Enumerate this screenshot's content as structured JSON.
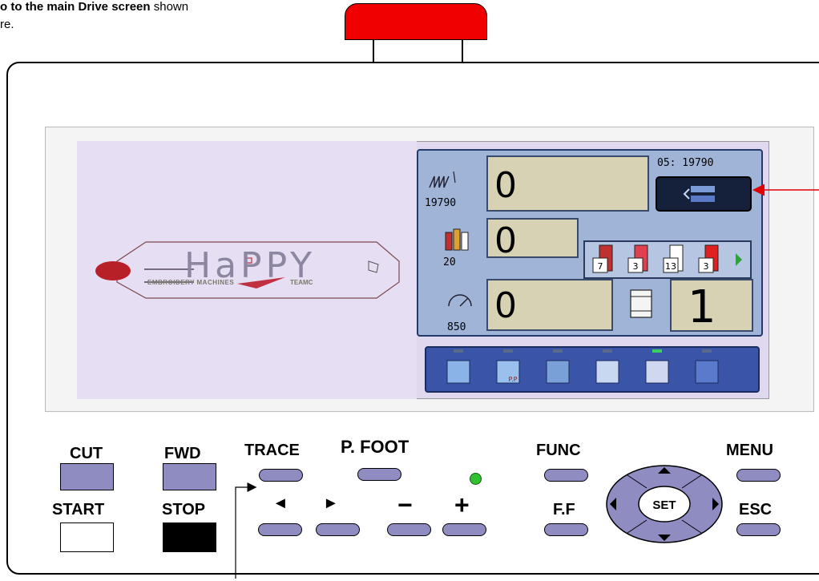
{
  "header": {
    "line1_bold": "o to the main Drive screen",
    "line1_rest": " shown",
    "line2": "re."
  },
  "colors": {
    "red_button": "#f00000",
    "key_fill": "#8f8cc2",
    "status_panel": "#9fb4d6",
    "value_display": "#d8d2b4",
    "icon_bar": "#3a55a8",
    "led": "#30c030",
    "callout_red": "#e00000"
  },
  "screen": {
    "logo_text": "HaPPY",
    "logo_sub_left": "EMBROIDERY MACHINES",
    "logo_sub_right": "TEAMC"
  },
  "status": {
    "stitch": {
      "icon": "stitch-count-icon",
      "total": "19790",
      "value": "0"
    },
    "design_counter": "05: 19790",
    "drive_button_icon": "drive-mode-icon",
    "color": {
      "icon": "thread-color-icon",
      "total": "20",
      "value": "0"
    },
    "needles": [
      {
        "number": "7",
        "color": "#c03030"
      },
      {
        "number": "3",
        "color": "#e04050"
      },
      {
        "number": "13",
        "color": "#ffffff"
      },
      {
        "number": "3",
        "color": "#e02020"
      }
    ],
    "next_icon": "next-arrow-icon",
    "speed": {
      "icon": "speed-gauge-icon",
      "total": "850",
      "value": "0"
    },
    "frame_icon": "frame-icon",
    "repeat_value": "1"
  },
  "icon_bar": {
    "items": [
      {
        "name": "design-select-icon"
      },
      {
        "name": "pattern-program-icon",
        "text": "P.P"
      },
      {
        "name": "thread-tension-icon"
      },
      {
        "name": "repeat-pattern-icon"
      },
      {
        "name": "frame-origin-icon"
      },
      {
        "name": "needle-setting-icon"
      }
    ]
  },
  "keypad": {
    "cut": "CUT",
    "fwd": "FWD",
    "start": "START",
    "stop": "STOP",
    "trace": "TRACE",
    "pfoot": "P. FOOT",
    "left": "◄",
    "right": "►",
    "minus": "−",
    "plus": "+",
    "func": "FUNC",
    "ff": "F.F",
    "menu": "MENU",
    "esc": "ESC",
    "set": "SET"
  }
}
